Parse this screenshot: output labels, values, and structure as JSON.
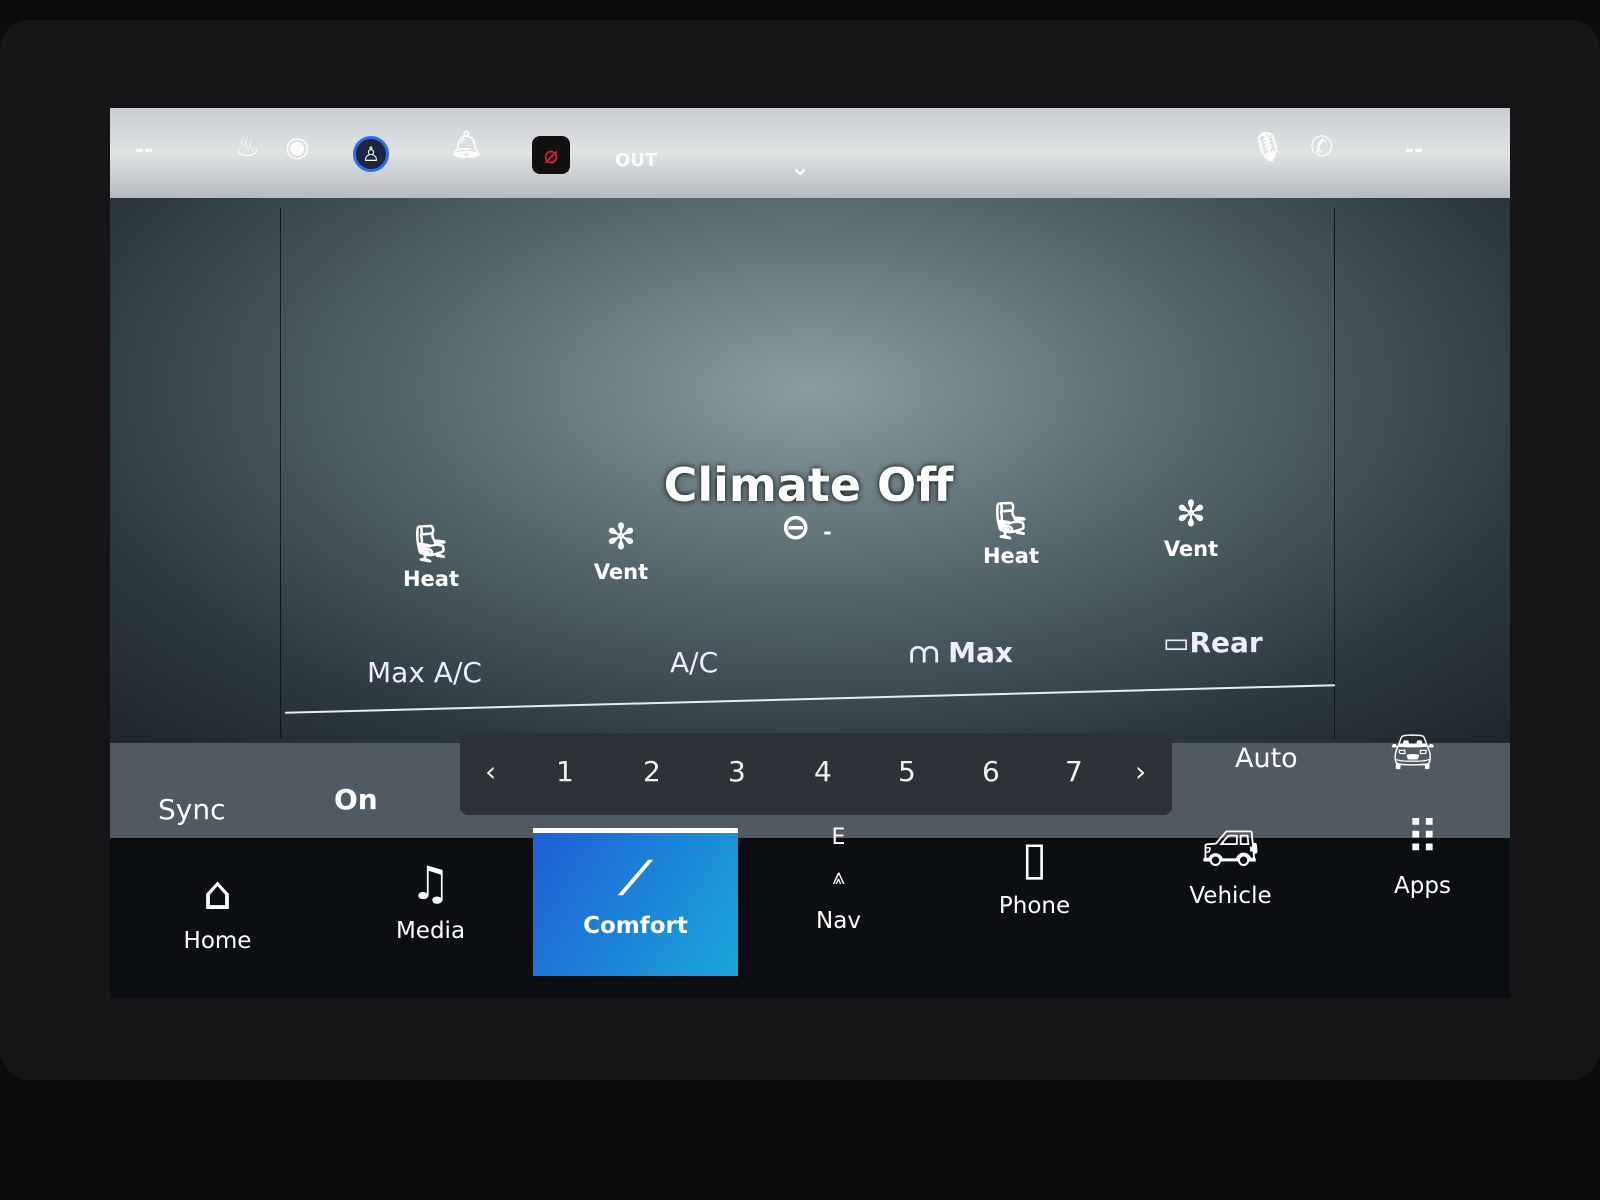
{
  "status_bar": {
    "left_text": "--",
    "outside_temp_label": "OUT",
    "right_text": "--",
    "icons": [
      "heated-steering-icon",
      "heated-seat-icon",
      "driver-profile-icon",
      "bell-icon",
      "wifi-off-icon",
      "chevron-down-icon",
      "microphone-icon",
      "phone-icon"
    ]
  },
  "climate": {
    "title": "Climate Off",
    "seats": [
      {
        "label": "Heat",
        "icon": "heated-seat-icon"
      },
      {
        "label": "Vent",
        "icon": "vented-seat-icon"
      },
      {
        "label": "",
        "icon": "heated-steering-wheel-icon",
        "level": "-"
      },
      {
        "label": "Heat",
        "icon": "heated-seat-icon"
      },
      {
        "label": "Vent",
        "icon": "vented-seat-icon"
      }
    ],
    "buttons": {
      "max_ac": "Max A/C",
      "ac": "A/C",
      "max_defrost": "Max",
      "rear_defrost": "Rear"
    }
  },
  "controls": {
    "sync": "Sync",
    "sync_state": "On",
    "fan_speeds": [
      "1",
      "2",
      "3",
      "4",
      "5",
      "6",
      "7"
    ],
    "prev": "‹",
    "next": "›",
    "auto": "Auto"
  },
  "nav": {
    "items": [
      {
        "label": "Home"
      },
      {
        "label": "Media"
      },
      {
        "label": "Comfort",
        "active": true
      },
      {
        "label": "Nav",
        "compass": "E"
      },
      {
        "label": "Phone"
      },
      {
        "label": "Vehicle"
      },
      {
        "label": "Apps"
      }
    ]
  },
  "colors": {
    "active_tab_start": "#1f5fd6",
    "active_tab_end": "#1aa6d8",
    "wifi_off": "#e0203a"
  }
}
